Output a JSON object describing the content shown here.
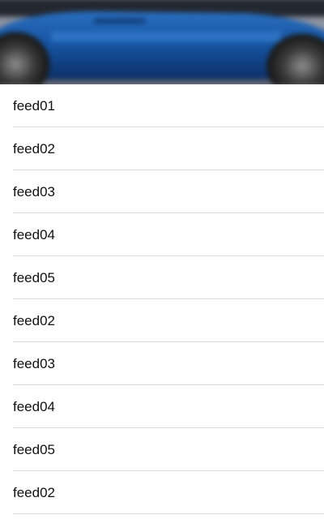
{
  "header": {
    "image_icon": "blurred-car-photo"
  },
  "feed": {
    "items": [
      {
        "label": "feed01"
      },
      {
        "label": "feed02"
      },
      {
        "label": "feed03"
      },
      {
        "label": "feed04"
      },
      {
        "label": "feed05"
      },
      {
        "label": "feed02"
      },
      {
        "label": "feed03"
      },
      {
        "label": "feed04"
      },
      {
        "label": "feed05"
      },
      {
        "label": "feed02"
      }
    ]
  },
  "colors": {
    "car_blue": "#1a5fae",
    "separator": "#d9d9dd",
    "text": "#111111"
  }
}
